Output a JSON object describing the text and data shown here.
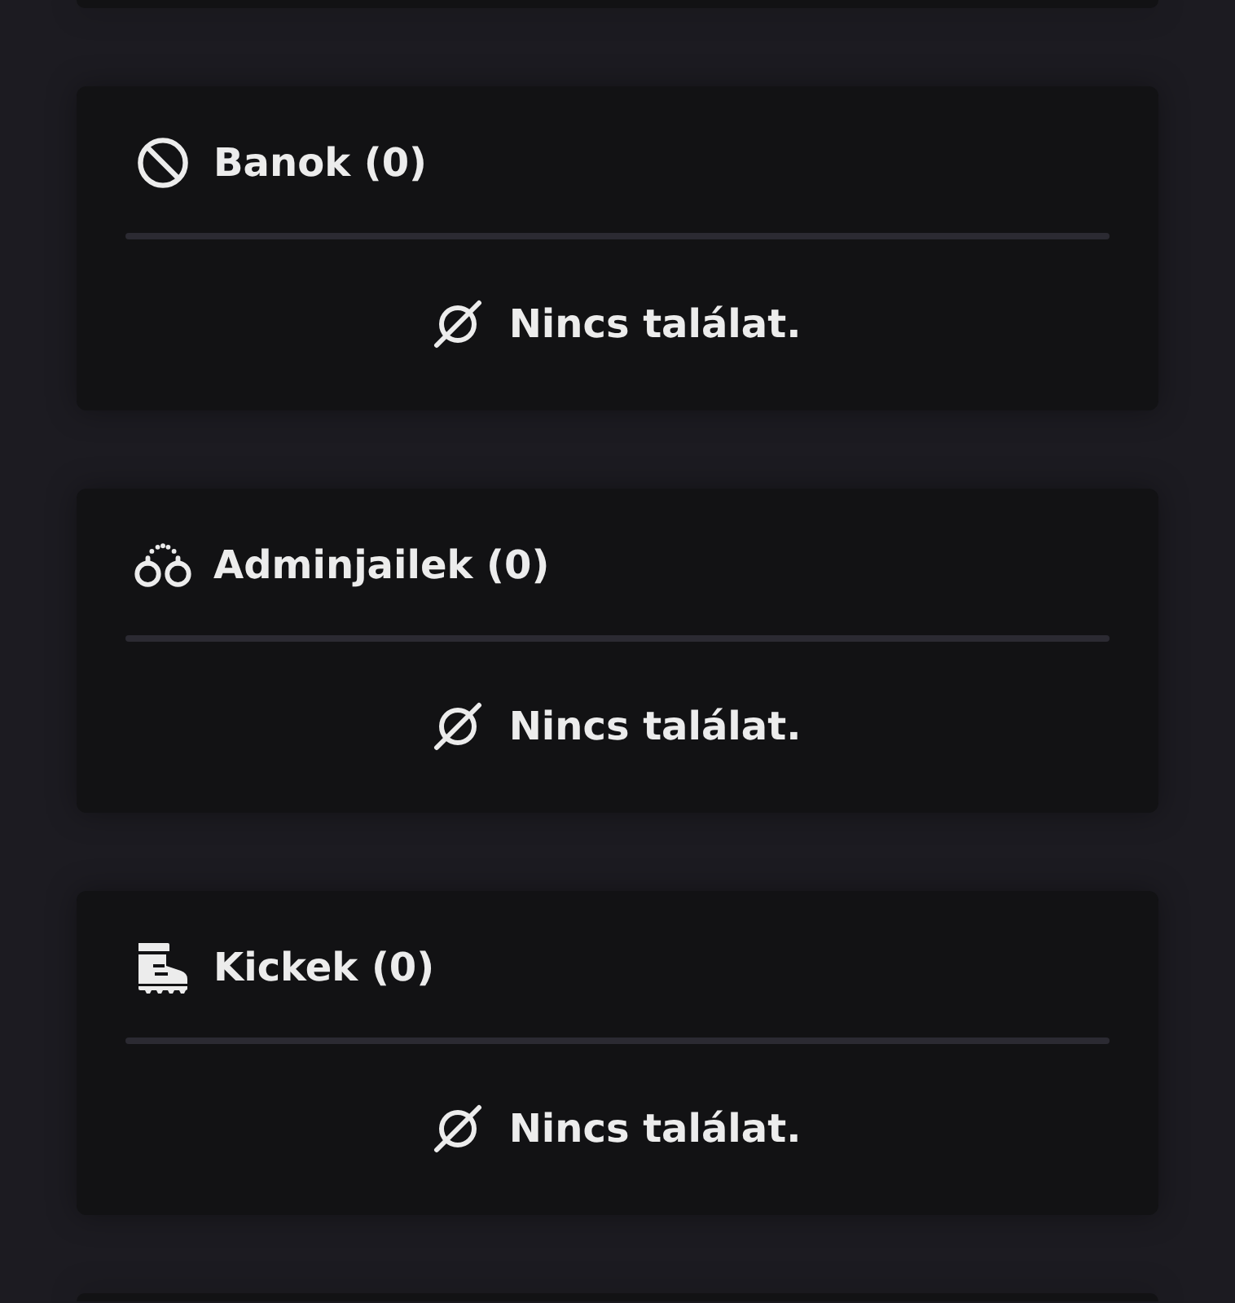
{
  "sections": [
    {
      "kind": "ban",
      "title": "Banok (0)",
      "empty_text": "Nincs találat."
    },
    {
      "kind": "jail",
      "title": "Adminjailek (0)",
      "empty_text": "Nincs találat."
    },
    {
      "kind": "kick",
      "title": "Kickek (0)",
      "empty_text": "Nincs találat."
    }
  ]
}
